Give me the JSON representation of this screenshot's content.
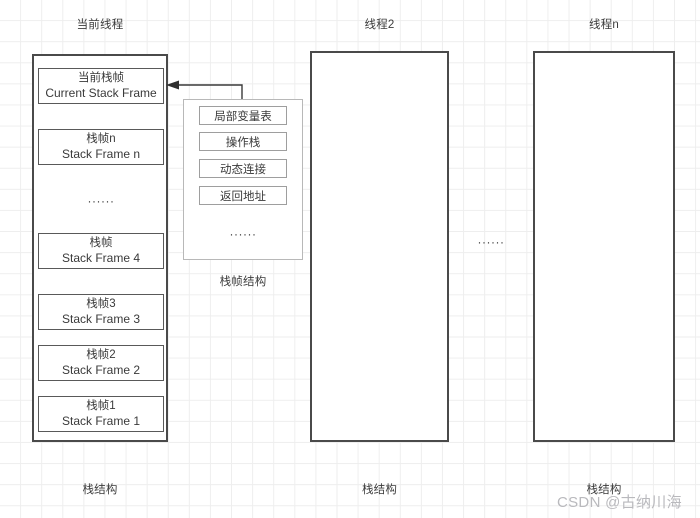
{
  "diagram": {
    "title_hidden": "",
    "threads": [
      {
        "id": "current-thread",
        "header": "当前线程",
        "footer": "栈结构",
        "frames": [
          {
            "cn": "当前栈帧",
            "en": "Current Stack Frame"
          },
          {
            "cn": "栈帧n",
            "en": "Stack Frame n"
          },
          {
            "cn": "栈帧",
            "en": "Stack Frame 4"
          },
          {
            "cn": "栈帧3",
            "en": "Stack Frame 3"
          },
          {
            "cn": "栈帧2",
            "en": "Stack Frame 2"
          },
          {
            "cn": "栈帧1",
            "en": "Stack Frame 1"
          }
        ],
        "frames_ellipsis": "······"
      },
      {
        "id": "thread-2",
        "header": "线程2",
        "footer": "栈结构",
        "frames": [],
        "frames_ellipsis": ""
      },
      {
        "id": "thread-n",
        "header": "线程n",
        "footer": "栈结构",
        "frames": [],
        "frames_ellipsis": ""
      }
    ],
    "threads_ellipsis": "······",
    "frame_structure": {
      "caption": "栈帧结构",
      "items": [
        "局部变量表",
        "操作栈",
        "动态连接",
        "返回地址"
      ],
      "ellipsis": "······"
    },
    "watermark": "CSDN @古纳川海",
    "colors": {
      "grid": "#eeeeee",
      "thread_border": "#4a4a4a",
      "frame_border": "#595959",
      "structure_border": "#b8b8b8",
      "item_border": "#9e9e9e",
      "text": "#3a3a3a",
      "watermark": "#b9b9bd",
      "connector": "#3a3a3a"
    }
  }
}
